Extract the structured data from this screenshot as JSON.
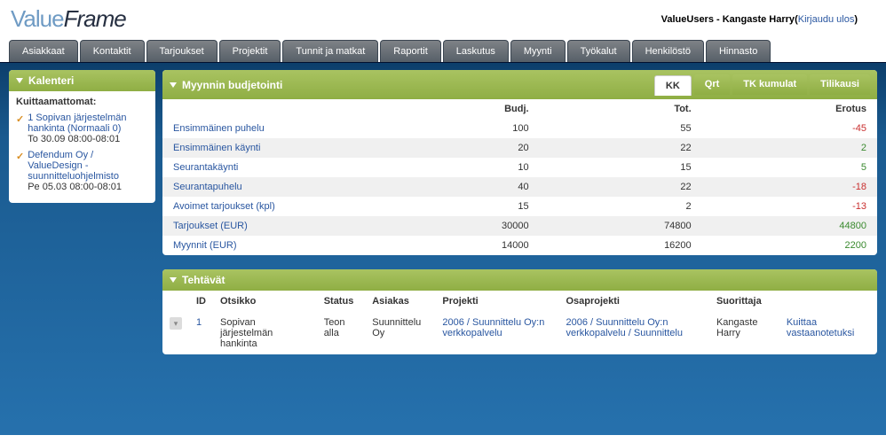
{
  "brand": {
    "part1": "Value",
    "part2": "Frame"
  },
  "user": {
    "prefix": "ValueUsers - ",
    "name": "Kangaste Harry",
    "logout": "Kirjaudu ulos"
  },
  "nav": [
    "Asiakkaat",
    "Kontaktit",
    "Tarjoukset",
    "Projektit",
    "Tunnit ja matkat",
    "Raportit",
    "Laskutus",
    "Myynti",
    "Työkalut",
    "Henkilöstö",
    "Hinnasto"
  ],
  "sidebar": {
    "title": "Kalenteri",
    "group_title": "Kuittaamattomat:",
    "items": [
      {
        "link": "1 Sopivan järjestelmän hankinta (Normaali 0)",
        "date": "To 30.09 08:00-08:01"
      },
      {
        "link": "Defendum Oy / ValueDesign -suunnitteluohjelmisto",
        "date": "Pe 05.03 08:00-08:01"
      }
    ]
  },
  "budget": {
    "title": "Myynnin budjetointi",
    "tabs": [
      "KK",
      "Qrt",
      "TK kumulat",
      "Tilikausi"
    ],
    "active_tab": 0,
    "headers": {
      "budj": "Budj.",
      "tot": "Tot.",
      "erotus": "Erotus"
    },
    "rows": [
      {
        "label": "Ensimmäinen puhelu",
        "budj": "100",
        "tot": "55",
        "erotus": "-45",
        "sign": "neg"
      },
      {
        "label": "Ensimmäinen käynti",
        "budj": "20",
        "tot": "22",
        "erotus": "2",
        "sign": "pos"
      },
      {
        "label": "Seurantakäynti",
        "budj": "10",
        "tot": "15",
        "erotus": "5",
        "sign": "pos"
      },
      {
        "label": "Seurantapuhelu",
        "budj": "40",
        "tot": "22",
        "erotus": "-18",
        "sign": "neg"
      },
      {
        "label": "Avoimet tarjoukset (kpl)",
        "budj": "15",
        "tot": "2",
        "erotus": "-13",
        "sign": "neg"
      },
      {
        "label": "Tarjoukset (EUR)",
        "budj": "30000",
        "tot": "74800",
        "erotus": "44800",
        "sign": "pos"
      },
      {
        "label": "Myynnit (EUR)",
        "budj": "14000",
        "tot": "16200",
        "erotus": "2200",
        "sign": "pos"
      }
    ]
  },
  "tasks": {
    "title": "Tehtävät",
    "headers": {
      "id": "ID",
      "otsikko": "Otsikko",
      "status": "Status",
      "asiakas": "Asiakas",
      "projekti": "Projekti",
      "osaprojekti": "Osaprojekti",
      "suorittaja": "Suorittaja",
      "actions": ""
    },
    "rows": [
      {
        "id": "1",
        "otsikko": "Sopivan järjestelmän hankinta",
        "status": "Teon alla",
        "asiakas": "Suunnittelu Oy",
        "projekti": "2006 / Suunnittelu Oy:n verkkopalvelu",
        "osaprojekti": "2006 / Suunnittelu Oy:n verkkopalvelu / Suunnittelu",
        "suorittaja": "Kangaste Harry",
        "action": "Kuittaa vastaanotetuksi"
      }
    ]
  }
}
